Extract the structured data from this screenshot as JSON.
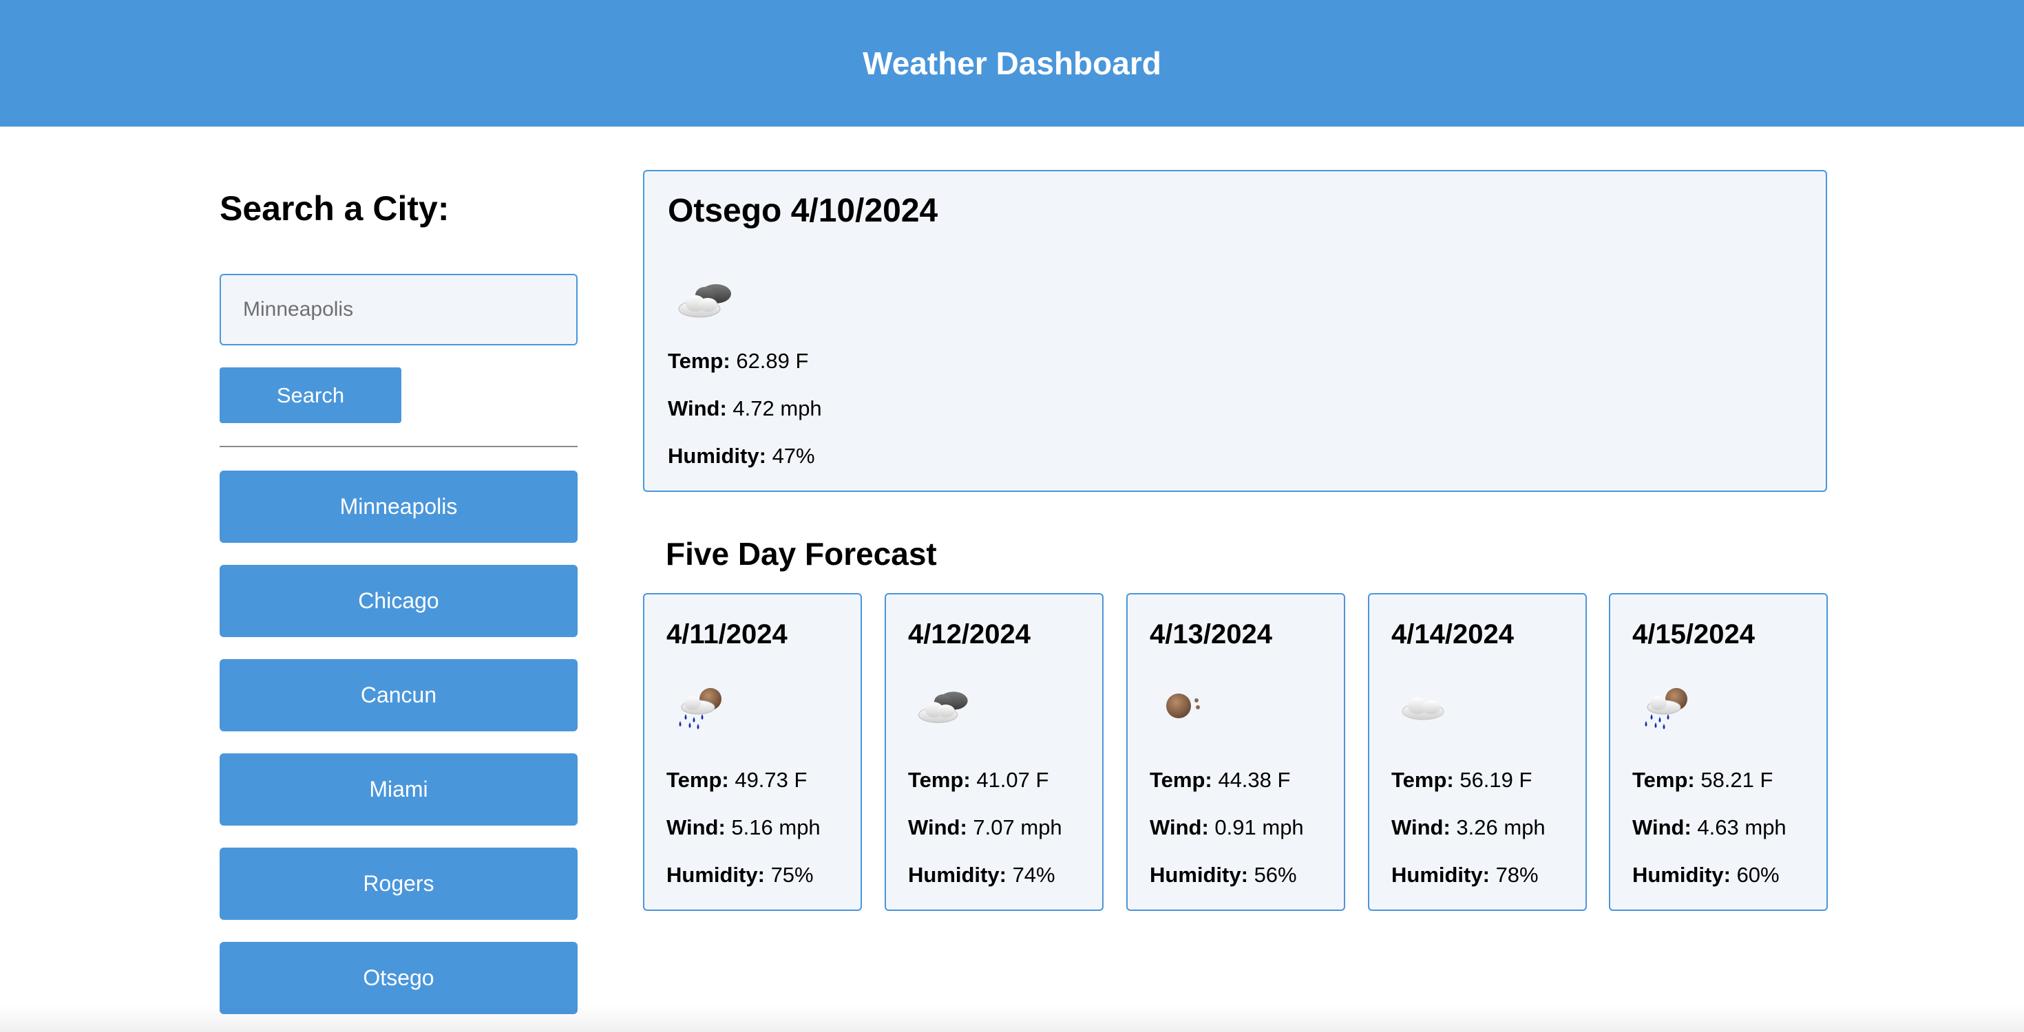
{
  "header": {
    "title": "Weather Dashboard",
    "bg_color": "#4a96db"
  },
  "sidebar": {
    "heading": "Search a City:",
    "search_placeholder": "Minneapolis",
    "search_button": "Search",
    "history": [
      "Minneapolis",
      "Chicago",
      "Cancun",
      "Miami",
      "Rogers",
      "Otsego"
    ]
  },
  "current": {
    "title": "Otsego 4/10/2024",
    "icon": "cloud-icon",
    "temp_label": "Temp:",
    "temp": "62.89 F",
    "wind_label": "Wind:",
    "wind": "4.72 mph",
    "humidity_label": "Humidity:",
    "humidity": "47%"
  },
  "forecast": {
    "title": "Five Day Forecast",
    "days": [
      {
        "date": "4/11/2024",
        "icon": "rain-icon",
        "temp": "49.73 F",
        "wind": "5.16 mph",
        "humidity": "75%"
      },
      {
        "date": "4/12/2024",
        "icon": "cloud-icon",
        "temp": "41.07 F",
        "wind": "7.07 mph",
        "humidity": "74%"
      },
      {
        "date": "4/13/2024",
        "icon": "sun-icon",
        "temp": "44.38 F",
        "wind": "0.91 mph",
        "humidity": "56%"
      },
      {
        "date": "4/14/2024",
        "icon": "light-cloud-icon",
        "temp": "56.19 F",
        "wind": "3.26 mph",
        "humidity": "78%"
      },
      {
        "date": "4/15/2024",
        "icon": "rain-icon",
        "temp": "58.21 F",
        "wind": "4.63 mph",
        "humidity": "60%"
      }
    ],
    "temp_label": "Temp:",
    "wind_label": "Wind:",
    "humidity_label": "Humidity:"
  }
}
